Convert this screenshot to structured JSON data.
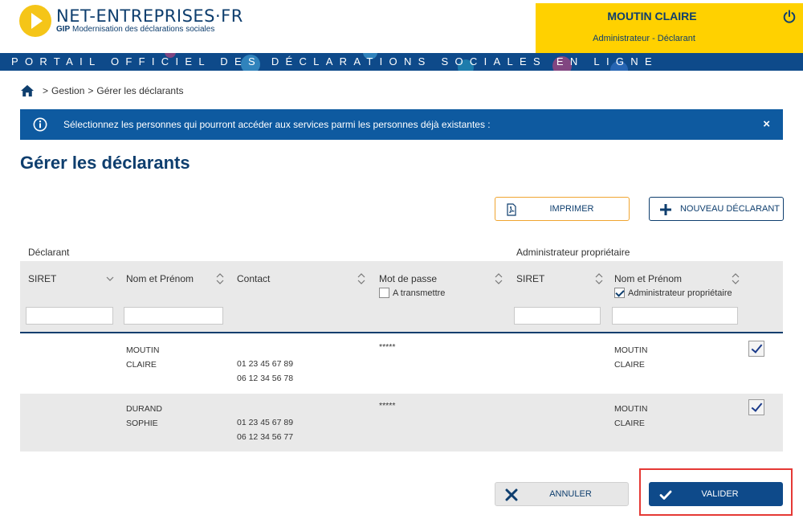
{
  "header": {
    "logo_name": "NET-ENTREPRISES·FR",
    "logo_sub_bold": "GIP",
    "logo_sub": "Modernisation des déclarations sociales",
    "user_name": "MOUTIN CLAIRE",
    "user_role": "Administrateur - Déclarant",
    "banner": "PORTAIL OFFICIEL DES DÉCLARATIONS SOCIALES EN LIGNE",
    "colors": {
      "brand": "#0e3e6e",
      "banner": "#0e4a8a",
      "user_box": "#ffd100"
    }
  },
  "breadcrumb": {
    "sep": ">",
    "items": [
      "Gestion",
      "Gérer les déclarants"
    ]
  },
  "alert": {
    "text": "Sélectionnez les personnes qui pourront accéder aux services parmi les personnes déjà existantes :",
    "close": "×"
  },
  "page_title": "Gérer les déclarants",
  "actions": {
    "print": "IMPRIMER",
    "new_declarant": "NOUVEAU DÉCLARANT",
    "cancel": "ANNULER",
    "validate": "VALIDER"
  },
  "table": {
    "group_declarant": "Déclarant",
    "group_admin": "Administrateur propriétaire",
    "columns": {
      "siret": "SIRET",
      "name": "Nom et Prénom",
      "contact": "Contact",
      "password": "Mot de passe",
      "admin_siret": "SIRET",
      "admin_name": "Nom et Prénom"
    },
    "filters": {
      "to_transmit": "A transmettre",
      "admin_owner": "Administrateur propriétaire"
    },
    "rows": [
      {
        "last_name": "MOUTIN",
        "first_name": "CLAIRE",
        "phone1": "01 23 45 67 89",
        "phone2": "06 12 34 56 78",
        "password": "*****",
        "admin_last": "MOUTIN",
        "admin_first": "CLAIRE"
      },
      {
        "last_name": "DURAND",
        "first_name": "SOPHIE",
        "phone1": "01 23 45 67 89",
        "phone2": "06 12 34 56 77",
        "password": "*****",
        "admin_last": "MOUTIN",
        "admin_first": "CLAIRE"
      }
    ]
  }
}
